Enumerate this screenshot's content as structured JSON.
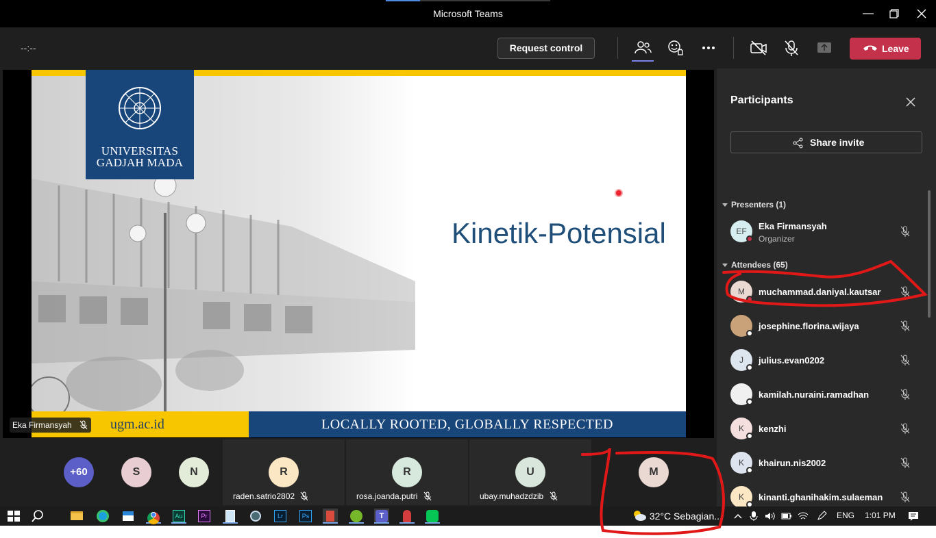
{
  "window": {
    "title": "Microsoft Teams"
  },
  "controls": {
    "timer": "--:--",
    "request_control": "Request control",
    "leave": "Leave",
    "leave_color": "#c4314b",
    "accent_color": "#7b83eb",
    "icons": [
      "people-icon",
      "react-icon",
      "more-icon",
      "camera-off-icon",
      "mic-off-icon",
      "share-tray-icon"
    ]
  },
  "slide": {
    "logo_line1": "UNIVERSITAS",
    "logo_line2": "GADJAH MADA",
    "title": "Kinetik-Potensial",
    "footer_left": "ugm.ac.id",
    "footer_right": "LOCALLY ROOTED, GLOBALLY RESPECTED",
    "brand_blue": "#18457a",
    "brand_yellow": "#f7c600"
  },
  "presenter_label": "Eka Firmansyah",
  "gallery": {
    "overflow": "+60",
    "avatars": [
      {
        "initial": "S",
        "color": "#e8cdd2"
      },
      {
        "initial": "N",
        "color": "#e3ecd9"
      }
    ],
    "tiles": [
      {
        "initial": "R",
        "name": "raden.satrio2802",
        "color": "#fbe7c4"
      },
      {
        "initial": "R",
        "name": "rosa.joanda.putri",
        "color": "#d7e8dc"
      },
      {
        "initial": "U",
        "name": "ubay.muhadzdzib",
        "color": "#d8e6dc"
      },
      {
        "initial": "M",
        "name": "",
        "color": "#ead8d3"
      }
    ]
  },
  "panel": {
    "title": "Participants",
    "share_invite": "Share invite",
    "presenters_header": "Presenters (1)",
    "presenters": [
      {
        "initials": "EF",
        "name": "Eka Firmansyah",
        "role": "Organizer",
        "avatar_color": "#d6eef0",
        "status": "#c4314b"
      }
    ],
    "attendees_header": "Attendees (65)",
    "attendees": [
      {
        "initials": "M",
        "name": "muchammad.daniyal.kautsar",
        "avatar_color": "#ead8d3",
        "status": "#c4314b"
      },
      {
        "initials": "",
        "name": "josephine.florina.wijaya",
        "avatar_color": "#c9a27a",
        "status": "#ffffff"
      },
      {
        "initials": "J",
        "name": "julius.evan0202",
        "avatar_color": "#dde5ee",
        "status": "#ffffff"
      },
      {
        "initials": "",
        "name": "kamilah.nuraini.ramadhan",
        "avatar_color": "#f0f0f0",
        "status": "#ffffff"
      },
      {
        "initials": "K",
        "name": "kenzhi",
        "avatar_color": "#f4dede",
        "status": "#ffffff"
      },
      {
        "initials": "K",
        "name": "khairun.nis2002",
        "avatar_color": "#dde3ef",
        "status": "#ffffff"
      },
      {
        "initials": "K",
        "name": "kinanti.ghanihakim.sulaeman",
        "avatar_color": "#fbe7c4",
        "status": "#ffffff"
      }
    ]
  },
  "taskbar": {
    "weather": "32°C  Sebagian...",
    "lang": "ENG",
    "time": "1:01 PM",
    "apps": [
      "start-icon",
      "search-icon",
      "file-explorer-icon",
      "edge-icon",
      "store-icon",
      "chrome-icon",
      "audition-icon",
      "premiere-icon",
      "notepad-icon",
      "obs-icon",
      "lightroom-icon",
      "photoshop-icon",
      "app-icon",
      "utorrent-icon",
      "teams-icon",
      "app2-icon",
      "line-icon"
    ]
  }
}
